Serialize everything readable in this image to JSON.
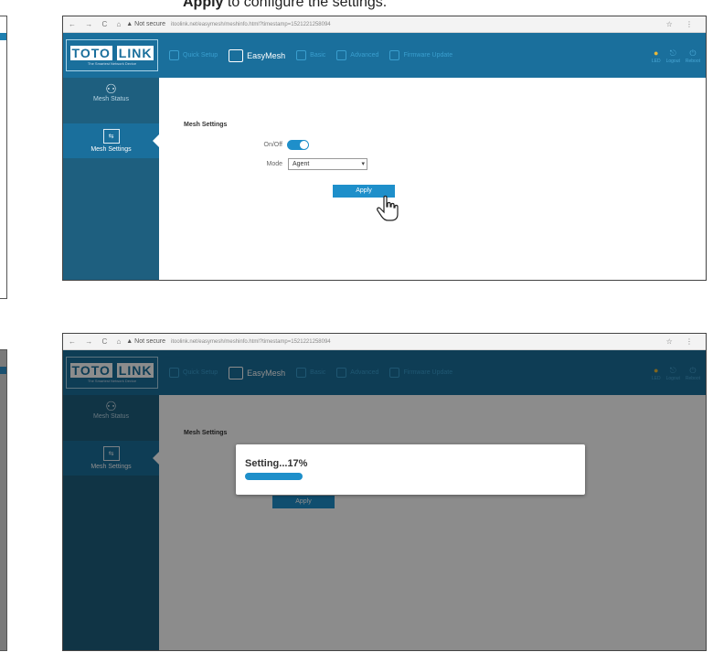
{
  "caption": {
    "bold": "Apply",
    "rest": " to configure the settings."
  },
  "browser": {
    "nav_glyphs": "← → C ⌂",
    "security": "▲ Not secure",
    "url": "itoolink.net/easymesh/meshinfo.html?timestamp=1521221258094",
    "right_icons": "☆ ⋮"
  },
  "header": {
    "logo_main": "TOTO",
    "logo_box": "LINK",
    "logo_sub": "The Smartest Network Device",
    "nav": [
      {
        "label": "Quick Setup"
      },
      {
        "label": "EasyMesh"
      },
      {
        "label": "Basic"
      },
      {
        "label": "Advanced"
      },
      {
        "label": "Firmware Update"
      }
    ],
    "right": [
      {
        "label": "LED"
      },
      {
        "label": "Logout"
      },
      {
        "label": "Reboot"
      }
    ]
  },
  "sidebar": {
    "items": [
      {
        "label": "Mesh Status"
      },
      {
        "label": "Mesh Settings"
      }
    ]
  },
  "settings": {
    "title": "Mesh Settings",
    "onoff_label": "On/Off",
    "onoff_state": "on",
    "mode_label": "Mode",
    "mode_value": "Agent",
    "apply_label": "Apply"
  },
  "modal": {
    "text": "Setting...17%",
    "progress_percent": 17
  },
  "colors": {
    "brand": "#1a6f9c",
    "accent": "#1e8fca",
    "sidebar": "#1e5f7f"
  }
}
